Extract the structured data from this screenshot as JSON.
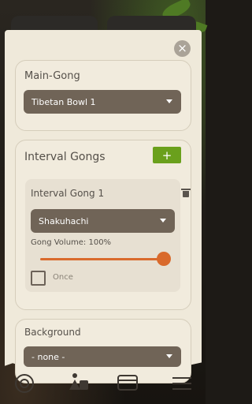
{
  "dialog": {
    "close_icon": "close-icon",
    "close_glyph": "×"
  },
  "main_gong": {
    "title": "Main-Gong",
    "selected": "Tibetan Bowl 1"
  },
  "interval_gongs": {
    "title": "Interval Gongs",
    "add_label": "+",
    "items": [
      {
        "title": "Interval Gong 1",
        "sound": "Shakuhachi",
        "volume_label": "Gong Volume: 100%",
        "volume": 1.0,
        "once_label": "Once",
        "once_checked": false
      }
    ]
  },
  "background": {
    "title": "Background",
    "selected": "- none -"
  },
  "bottom_nav": [
    "gong-icon",
    "meditator-icon",
    "presets-icon",
    "menu-icon"
  ],
  "colors": {
    "accent": "#6aa01c",
    "slider": "#d96a2c",
    "dropdown": "#706457",
    "paper": "#efe9da"
  }
}
